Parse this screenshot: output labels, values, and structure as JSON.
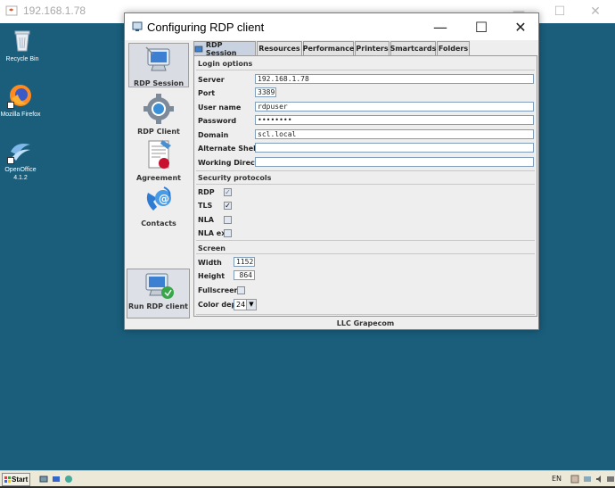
{
  "outer_window": {
    "title": "192.168.1.78",
    "minimize_glyph": "—",
    "maximize_glyph": "☐",
    "close_glyph": "✕"
  },
  "desktop": {
    "icons": [
      {
        "label": "Recycle Bin",
        "icon": "recycle-bin-icon"
      },
      {
        "label": "Mozilla Firefox",
        "icon": "firefox-icon"
      },
      {
        "label": "OpenOffice 4.1.2",
        "icon": "openoffice-icon"
      }
    ]
  },
  "dialog": {
    "title": "Configuring RDP client",
    "minimize_glyph": "—",
    "maximize_glyph": "☐",
    "close_glyph": "✕",
    "sidebar": [
      {
        "label": "RDP Session",
        "icon": "rdp-session-icon",
        "active": true
      },
      {
        "label": "RDP Client",
        "icon": "gear-icon",
        "active": false
      },
      {
        "label": "Agreement",
        "icon": "agreement-icon",
        "active": false
      },
      {
        "label": "Contacts",
        "icon": "contacts-icon",
        "active": false
      }
    ],
    "run_button": {
      "label": "Run RDP client",
      "icon": "run-rdp-icon"
    },
    "tabs": [
      {
        "label": "RDP Session",
        "active": true
      },
      {
        "label": "Resources",
        "active": false
      },
      {
        "label": "Performance",
        "active": false
      },
      {
        "label": "Printers",
        "active": false
      },
      {
        "label": "Smartcards",
        "active": false
      },
      {
        "label": "Folders",
        "active": false
      }
    ],
    "login": {
      "title": "Login options",
      "server_label": "Server",
      "server_value": "192.168.1.78",
      "port_label": "Port",
      "port_value": "3389",
      "username_label": "User name",
      "username_value": "rdpuser",
      "password_label": "Password",
      "password_value": "••••••••",
      "domain_label": "Domain",
      "domain_value": "scl.local",
      "shell_label": "Alternate Shell",
      "shell_value": "",
      "workdir_label": "Working Directory",
      "workdir_value": ""
    },
    "security": {
      "title": "Security protocols",
      "rdp_label": "RDP",
      "rdp_checked": true,
      "tls_label": "TLS",
      "tls_checked": true,
      "nla_label": "NLA",
      "nla_checked": false,
      "nlaex_label": "NLA ex",
      "nlaex_checked": false,
      "check_glyph": "✓"
    },
    "screen": {
      "title": "Screen",
      "width_label": "Width",
      "width_value": "1152",
      "height_label": "Height",
      "height_value": "864",
      "fullscreen_label": "Fullscreen",
      "fullscreen_checked": false,
      "depth_label": "Color depth",
      "depth_value": "24",
      "dropdown_glyph": "▼"
    },
    "footer": "LLC Grapecom"
  },
  "taskbar": {
    "start_label": "Start",
    "lang": "EN"
  },
  "colors": {
    "desktop": "#1a5e7c",
    "dialog_bg": "#eeeeee",
    "active_tab": "#c8d2e0"
  }
}
